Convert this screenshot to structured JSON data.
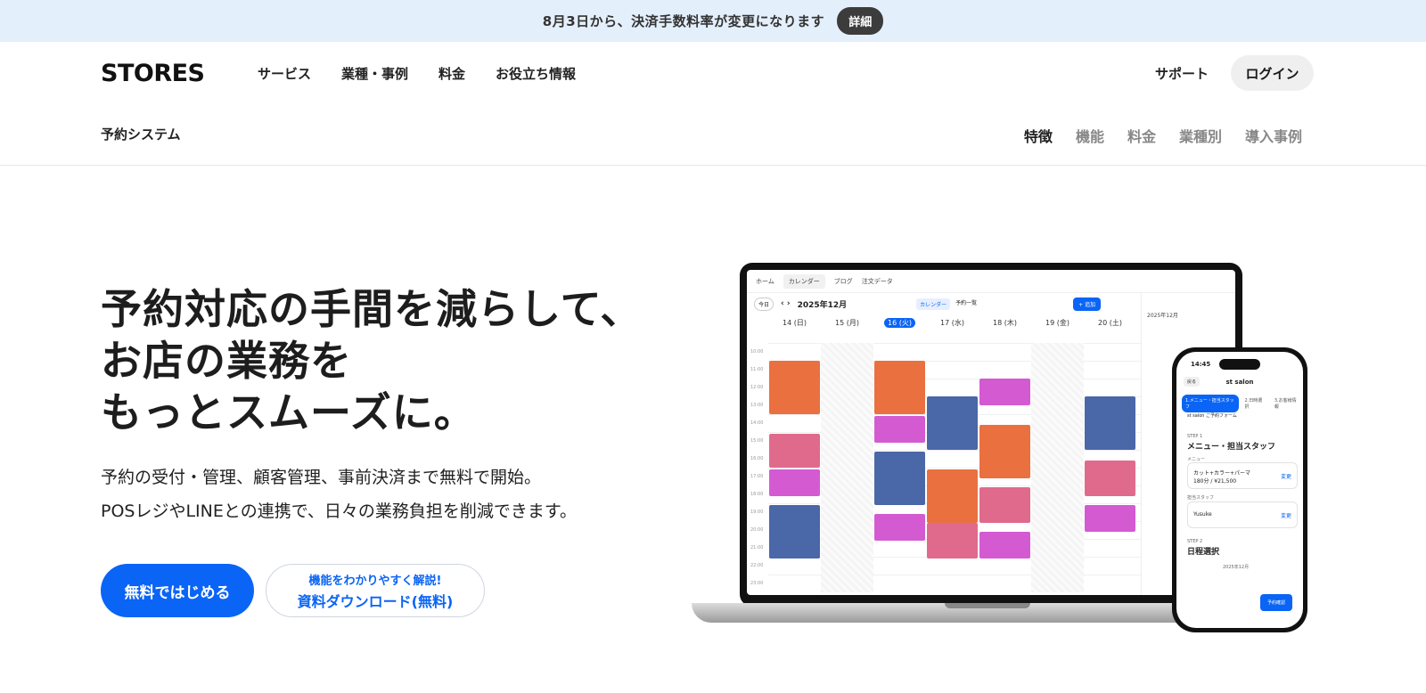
{
  "announcement": {
    "text": "8月3日から、決済手数料率が変更になります",
    "button": "詳細"
  },
  "header": {
    "logo": "STORES",
    "nav": [
      "サービス",
      "業種・事例",
      "料金",
      "お役立ち情報"
    ],
    "support": "サポート",
    "login": "ログイン"
  },
  "subnav": {
    "title": "予約システム",
    "links": [
      "特徴",
      "機能",
      "料金",
      "業種別",
      "導入事例"
    ],
    "active_index": 0
  },
  "hero": {
    "title_lines": [
      "予約対応の手間を減らして、",
      "お店の業務を",
      "もっとスムーズに。"
    ],
    "desc_lines": [
      "予約の受付・管理、顧客管理、事前決済まで無料で開始。",
      "POSレジやLINEとの連携で、日々の業務負担を削減できます。"
    ],
    "cta_primary": "無料ではじめる",
    "cta_secondary_top": "機能をわかりやすく解説!",
    "cta_secondary_bottom": "資料ダウンロード(無料)"
  },
  "laptop_app": {
    "tabs": [
      "ホーム",
      "カレンダー",
      "ブログ",
      "注文データ"
    ],
    "today": "今日",
    "month": "2025年12月",
    "view_tabs": [
      "カレンダー",
      "予約一覧"
    ],
    "add": "+ 追加",
    "days": [
      "14 (日)",
      "15 (月)",
      "16 (火)",
      "17 (水)",
      "18 (木)",
      "19 (金)",
      "20 (土)"
    ],
    "times": [
      "10:00",
      "11:00",
      "12:00",
      "13:00",
      "14:00",
      "15:00",
      "16:00",
      "17:00",
      "18:00",
      "19:00",
      "20:00",
      "21:00",
      "22:00",
      "23:00"
    ],
    "side_month": "2025年12月"
  },
  "phone_app": {
    "time": "14:45",
    "back": "戻る",
    "title": "st salon",
    "tabs": [
      "1.メニュー・担当スタッフ",
      "2.日時選択",
      "3.お客様情報"
    ],
    "shop": "st salon ご予約フォーム",
    "step1": "STEP 1",
    "step1_title": "メニュー・担当スタッフ",
    "menu_label": "メニュー",
    "menu_item": "カット+カラー+パーマ",
    "menu_price": "180分 / ¥21,500",
    "change": "変更",
    "staff_label": "担当スタッフ",
    "staff_name": "Yusuke",
    "step2": "STEP 2",
    "step2_title": "日程選択",
    "month": "2025年12月",
    "confirm": "予約確認"
  },
  "colors": {
    "accent": "#0a64f5",
    "announce_bg": "#e4effc"
  }
}
